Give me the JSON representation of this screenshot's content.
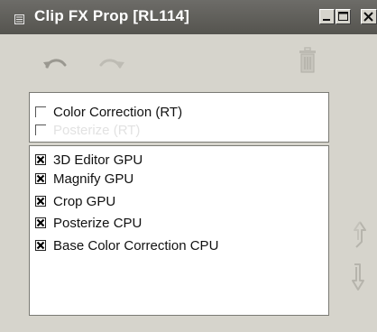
{
  "window": {
    "title": "Clip FX Prop [RL114]"
  },
  "icons": {
    "menu": "window-menu-icon",
    "minimize": "minimize-icon",
    "maximize": "maximize-icon",
    "close": "close-icon",
    "undo": "undo-icon",
    "redo": "redo-icon",
    "trash": "trash-icon",
    "up": "move-up-icon",
    "down": "move-down-icon"
  },
  "colors": {
    "titlebar": "#5f5e59",
    "panel": "#d6d4cc",
    "list_bg": "#ffffff",
    "disabled_icon": "#b4b2aa"
  },
  "available_effects": [
    {
      "label": "Color Correction (RT)",
      "checked": false,
      "faded": false
    },
    {
      "label": "Posterize (RT)",
      "checked": false,
      "faded": true
    }
  ],
  "applied_effects": [
    {
      "label": "3D Editor GPU",
      "checked": true
    },
    {
      "label": "Magnify GPU",
      "checked": true
    },
    {
      "label": "Crop GPU",
      "checked": true
    },
    {
      "label": "Posterize CPU",
      "checked": true
    },
    {
      "label": "Base Color Correction CPU",
      "checked": true
    }
  ]
}
